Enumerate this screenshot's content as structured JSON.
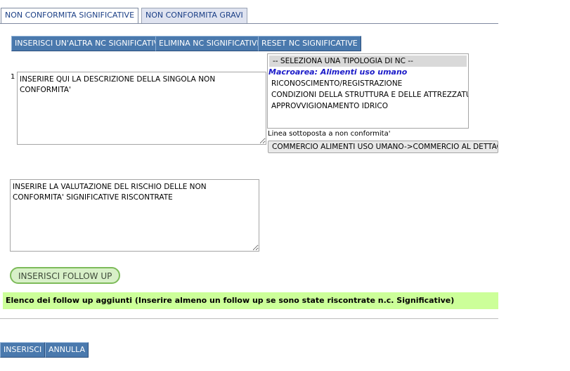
{
  "tabs": [
    {
      "label": "NON CONFORMITA SIGNIFICATIVE"
    },
    {
      "label": "NON CONFORMITA GRAVI"
    }
  ],
  "actions": {
    "add_nc": "INSERISCI UN'ALTRA NC SIGNIFICATIVE",
    "delete_nc": "ELIMINA NC SIGNIFICATIVE",
    "reset_nc": "RESET NC SIGNIFICATIVE"
  },
  "nc_item": {
    "index": "1",
    "description": "INSERIRE QUI LA DESCRIZIONE DELLA SINGOLA NON CONFORMITA'"
  },
  "nc_type_list": {
    "placeholder": "-- SELEZIONA UNA TIPOLOGIA DI NC --",
    "group_label": "Macroarea: Alimenti uso umano",
    "options": [
      "RICONOSCIMENTO/REGISTRAZIONE",
      "CONDIZIONI DELLA STRUTTURA E DELLE ATTREZZATURE",
      "APPROVVIGIONAMENTO IDRICO"
    ]
  },
  "line": {
    "label": "Linea sottoposta a non conformita'",
    "selected": "COMMERCIO ALIMENTI USO UMANO->COMMERCIO AL DETTAGLIO"
  },
  "risk_assessment": "INSERIRE LA VALUTAZIONE DEL RISCHIO DELLE NON CONFORMITA' SIGNIFICATIVE RISCONTRATE",
  "follow_up": {
    "button": "INSERISCI FOLLOW UP",
    "list_title": "Elenco dei follow up aggiunti (Inserire almeno un follow up se sono state riscontrate n.c. Significative)"
  },
  "footer": {
    "submit": "INSERISCI",
    "cancel": "ANNULLA"
  },
  "colors": {
    "button_blue": "#4a79ad",
    "tab_text": "#1b3f86",
    "followup_band": "#ccff99",
    "group_label": "#1a1ac8"
  }
}
